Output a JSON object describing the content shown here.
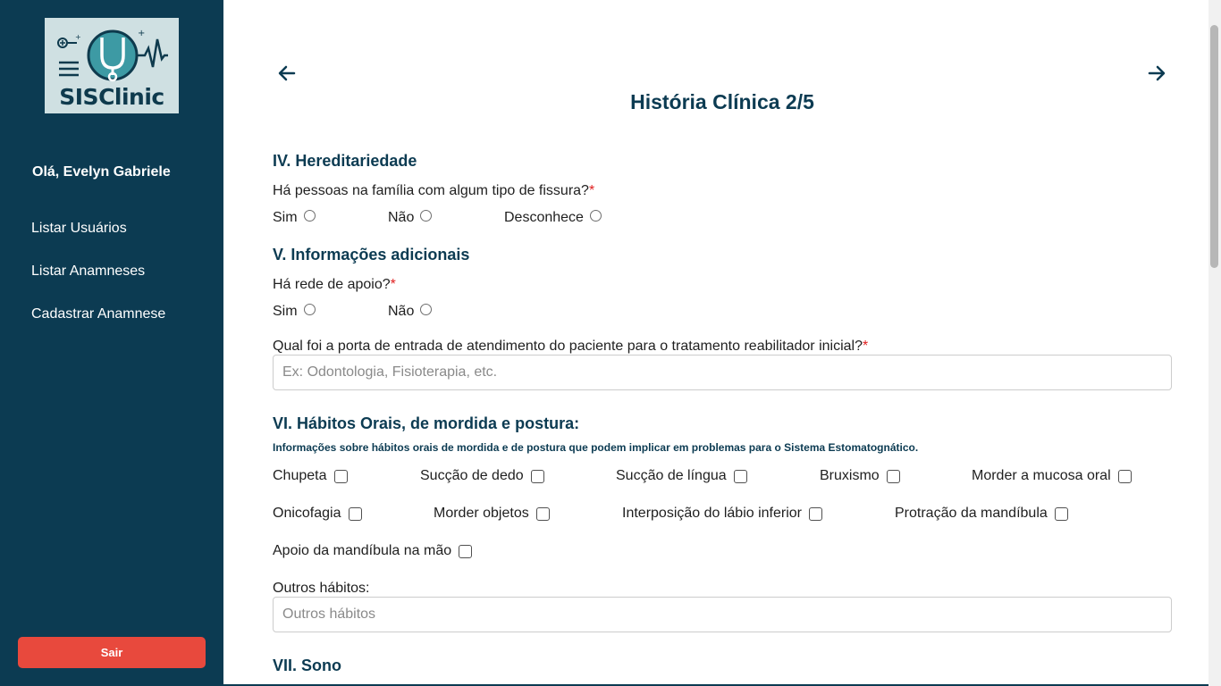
{
  "sidebar": {
    "logo_text": "SISClinic",
    "greeting": "Olá, Evelyn Gabriele",
    "items": [
      {
        "label": "Listar Usuários"
      },
      {
        "label": "Listar Anamneses"
      },
      {
        "label": "Cadastrar Anamnese"
      }
    ],
    "logout_label": "Sair"
  },
  "main": {
    "title": "História Clínica  2/5",
    "sections": {
      "hereditariedade": {
        "title": "IV. Hereditariedade",
        "question": "Há pessoas na família com algum tipo de fissura?",
        "required_mark": "*",
        "options": [
          "Sim",
          "Não",
          "Desconhece"
        ]
      },
      "informacoes": {
        "title": "V. Informações adicionais",
        "question": "Há rede de apoio?",
        "required_mark": "*",
        "options": [
          "Sim",
          "Não"
        ],
        "entry_question": "Qual foi a porta de entrada de atendimento do paciente para o tratamento reabilitador inicial?",
        "entry_placeholder": "Ex: Odontologia, Fisioterapia, etc."
      },
      "habitos": {
        "title": "VI. Hábitos Orais, de mordida e postura:",
        "note": "Informações sobre hábitos orais de mordida e de postura que podem implicar em problemas para o Sistema Estomatognático.",
        "checkboxes": [
          "Chupeta",
          "Sucção de dedo",
          "Sucção de língua",
          "Bruxismo",
          "Morder a mucosa oral",
          "Onicofagia",
          "Morder objetos",
          "Interposição do lábio inferior",
          "Protração da mandíbula",
          "Apoio da mandíbula na mão"
        ],
        "other_label": "Outros hábitos:",
        "other_placeholder": "Outros hábitos"
      },
      "sono": {
        "title": "VII. Sono"
      }
    }
  },
  "colors": {
    "sidebar_bg": "#0c3b52",
    "accent": "#0c3b52",
    "logout": "#e8493d",
    "required": "#e02020"
  },
  "icons": {
    "back": "arrow-left-icon",
    "forward": "arrow-right-icon",
    "logo": "stethoscope-heartbeat-logo"
  }
}
